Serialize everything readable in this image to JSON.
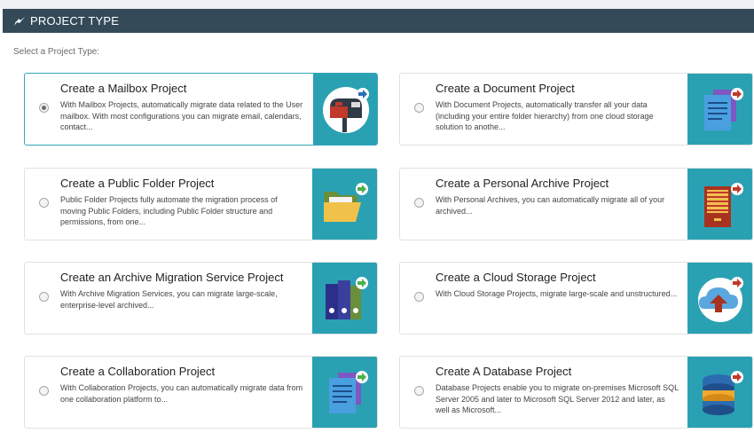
{
  "header": {
    "title": "PROJECT TYPE",
    "icon": "rocket-icon"
  },
  "subtitle": "Select a Project Type:",
  "colors": {
    "header_bg": "#344a59",
    "icon_bg": "#2aa1b3",
    "selected_border": "#34a6b8"
  },
  "cards": [
    {
      "title": "Create a Mailbox Project",
      "description": "With Mailbox Projects, automatically migrate data related to the User mailbox. With most configurations you can migrate email, calendars, contact...",
      "icon": "mailbox-icon",
      "selected": true
    },
    {
      "title": "Create a Document Project",
      "description": "With Document Projects, automatically transfer all your data (including your entire folder hierarchy) from one cloud storage solution to anothe...",
      "icon": "document-icon",
      "selected": false
    },
    {
      "title": "Create a Public Folder Project",
      "description": "Public Folder Projects fully automate the migration process of moving Public Folders, including Public Folder structure and permissions, from one...",
      "icon": "folder-icon",
      "selected": false
    },
    {
      "title": "Create a Personal Archive Project",
      "description": "With Personal Archives, you can automatically migrate all of your archived...",
      "icon": "archive-drawer-icon",
      "selected": false
    },
    {
      "title": "Create an Archive Migration Service Project",
      "description": "With Archive Migration Services, you can migrate large-scale, enterprise-level archived...",
      "icon": "binders-icon",
      "selected": false
    },
    {
      "title": "Create a Cloud Storage Project",
      "description": "With Cloud Storage Projects, migrate large-scale and unstructured...",
      "icon": "cloud-upload-icon",
      "selected": false
    },
    {
      "title": "Create a Collaboration Project",
      "description": "With Collaboration Projects, you can automatically migrate data from one collaboration platform to...",
      "icon": "collaboration-document-icon",
      "selected": false
    },
    {
      "title": "Create A Database Project",
      "description": "Database Projects enable you to migrate on-premises Microsoft SQL Server 2005 and later to Microsoft SQL Server 2012 and later, as well as Microsoft...",
      "icon": "database-icon",
      "selected": false
    }
  ]
}
